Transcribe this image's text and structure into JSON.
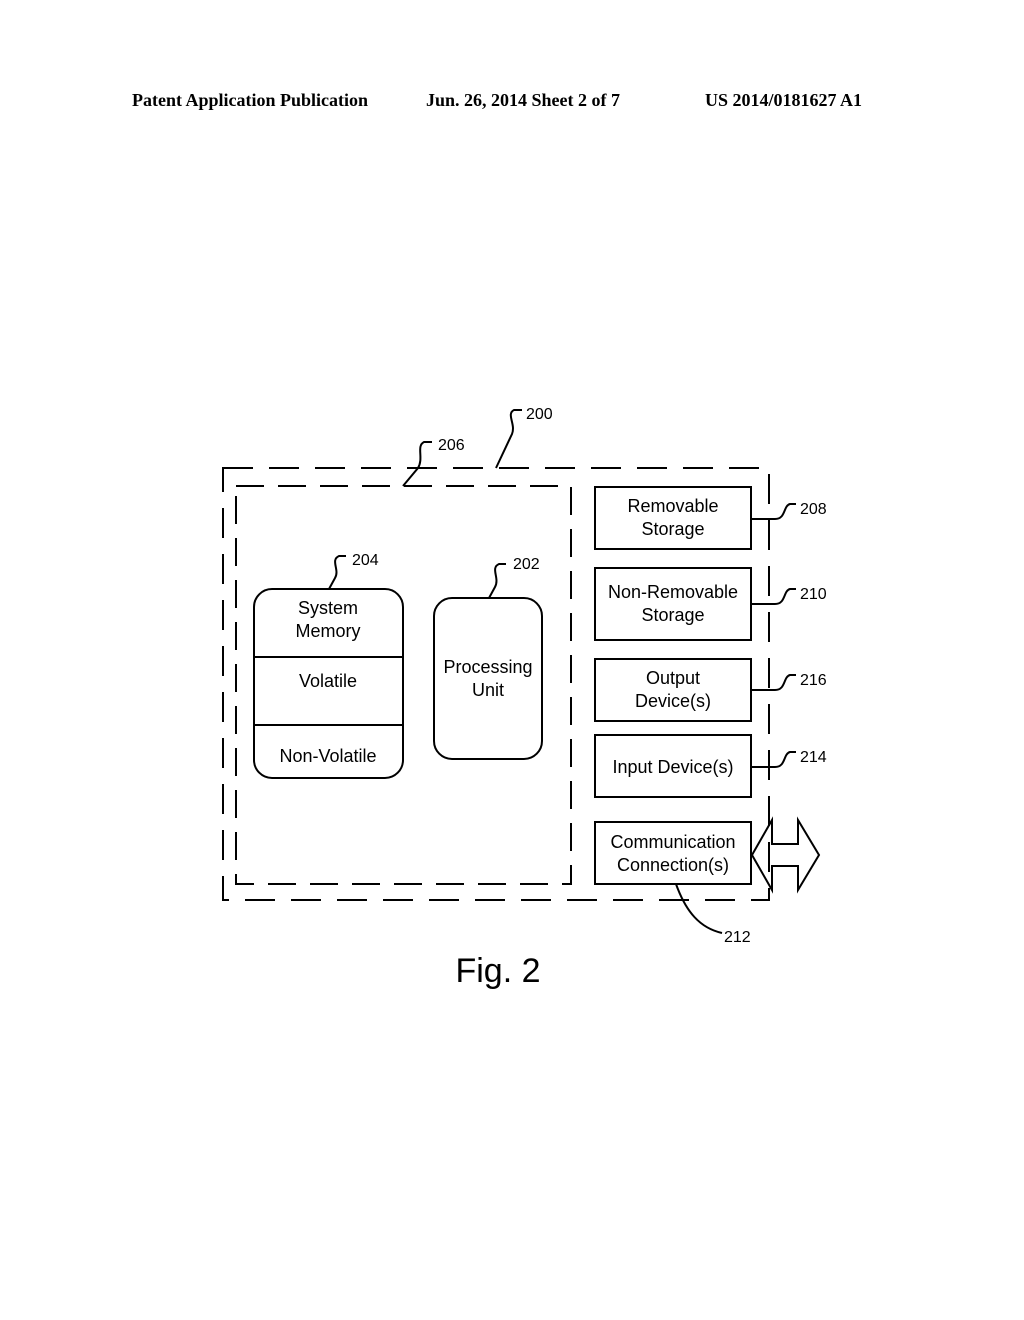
{
  "header": {
    "left": "Patent Application Publication",
    "center": "Jun. 26, 2014  Sheet 2 of 7",
    "right": "US 2014/0181627 A1"
  },
  "figure": {
    "caption": "Fig. 2",
    "refs": {
      "outer": "200",
      "inner": "206",
      "memory": "204",
      "processing": "202",
      "removable": "208",
      "non_removable": "210",
      "output": "216",
      "input": "214",
      "communication": "212"
    },
    "memory": {
      "title_line1": "System",
      "title_line2": "Memory",
      "volatile": "Volatile",
      "non_volatile": "Non-Volatile"
    },
    "processing": {
      "line1": "Processing",
      "line2": "Unit"
    },
    "removable": {
      "line1": "Removable",
      "line2": "Storage"
    },
    "non_removable": {
      "line1": "Non-Removable",
      "line2": "Storage"
    },
    "output": {
      "line1": "Output",
      "line2": "Device(s)"
    },
    "input": {
      "line1": "Input Device(s)"
    },
    "communication": {
      "line1": "Communication",
      "line2": "Connection(s)"
    }
  }
}
